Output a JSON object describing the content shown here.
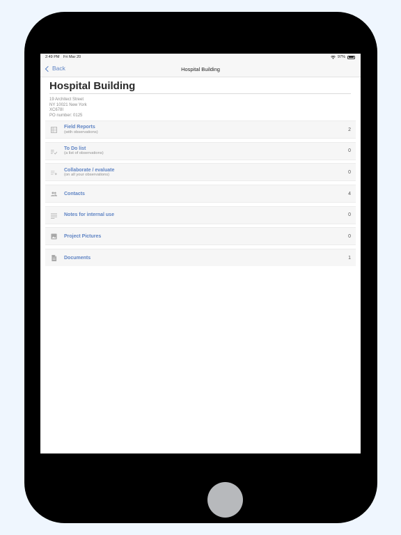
{
  "status_bar": {
    "time": "2:49 PM",
    "date": "Fri Mar 20",
    "battery": "97%"
  },
  "nav": {
    "back_label": "Back",
    "title": "Hospital Building"
  },
  "project": {
    "title": "Hospital Building",
    "address_lines": [
      "19 Architect Street",
      "NY 10021 New York",
      "XC678I",
      "PO number: 0125"
    ]
  },
  "items": [
    {
      "label": "Field Reports",
      "sub": "(with observations)",
      "count": "2",
      "icon": "grid-report-icon"
    },
    {
      "label": "To Do list",
      "sub": "(a list of observations)",
      "count": "0",
      "icon": "checklist-icon"
    },
    {
      "label": "Collaborate / evaluate",
      "sub": "(on all your observations)",
      "count": "0",
      "icon": "list-star-icon"
    },
    {
      "label": "Contacts",
      "sub": "",
      "count": "4",
      "icon": "people-icon"
    },
    {
      "label": "Notes for internal use",
      "sub": "",
      "count": "0",
      "icon": "notes-icon"
    },
    {
      "label": "Project Pictures",
      "sub": "",
      "count": "0",
      "icon": "image-icon"
    },
    {
      "label": "Documents",
      "sub": "",
      "count": "1",
      "icon": "document-icon"
    }
  ],
  "colors": {
    "accent": "#5f84c4",
    "background": "#eff6fe",
    "device": "#000000",
    "home_button": "#b7b9bc"
  }
}
